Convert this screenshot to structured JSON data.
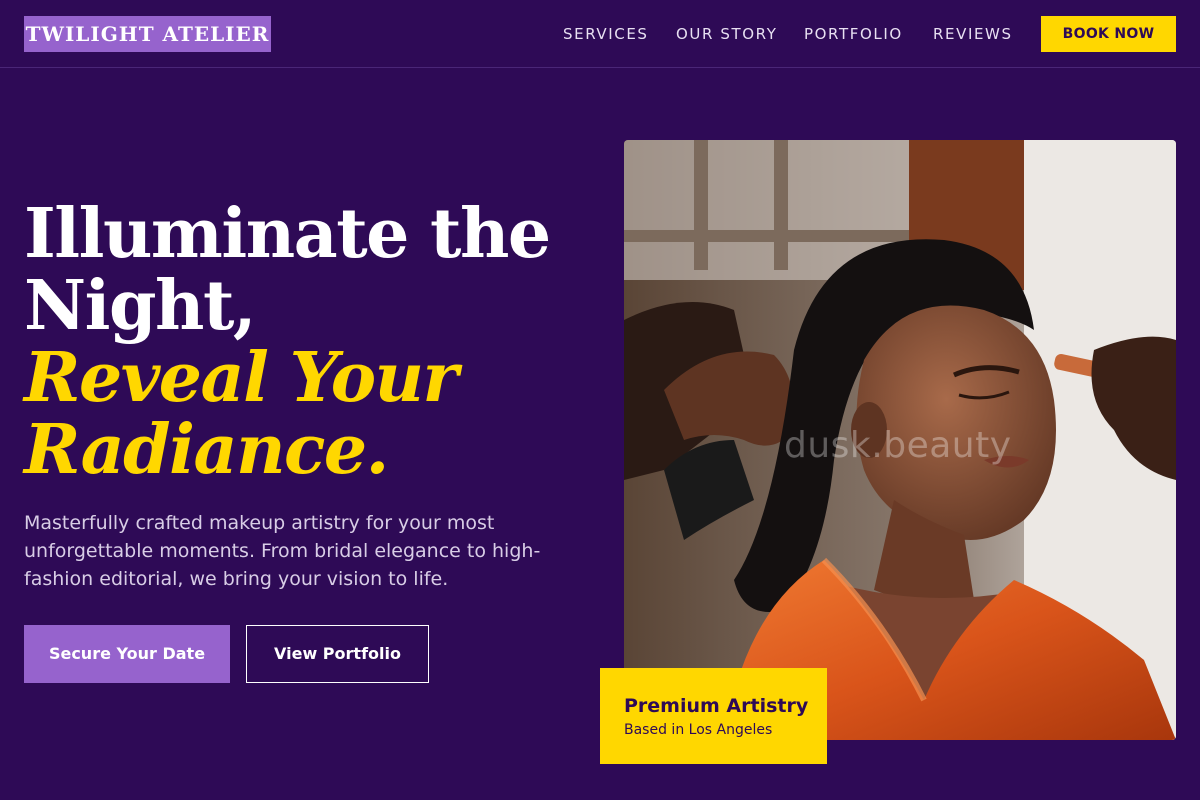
{
  "brand": {
    "name": "TWILIGHT ATELIER"
  },
  "nav": {
    "items": [
      {
        "label": "SERVICES"
      },
      {
        "label": "OUR STORY"
      },
      {
        "label": "PORTFOLIO"
      },
      {
        "label": "REVIEWS"
      }
    ],
    "cta_label": "BOOK NOW"
  },
  "hero": {
    "headline_line1": "Illuminate the",
    "headline_line2": "Night,",
    "headline_accent_line1": "Reveal Your",
    "headline_accent_line2": "Radiance.",
    "description": "Masterfully crafted makeup artistry for your most unforgettable moments. From bridal elegance to high-fashion editorial, we bring your vision to life.",
    "primary_button": "Secure Your Date",
    "secondary_button": "View Portfolio"
  },
  "image": {
    "watermark": "dusk.beauty"
  },
  "badge": {
    "title": "Premium Artistry",
    "subtitle": "Based in Los Angeles"
  },
  "colors": {
    "background": "#2e0a56",
    "accent_purple": "#9663cd",
    "accent_gold": "#ffd700"
  }
}
